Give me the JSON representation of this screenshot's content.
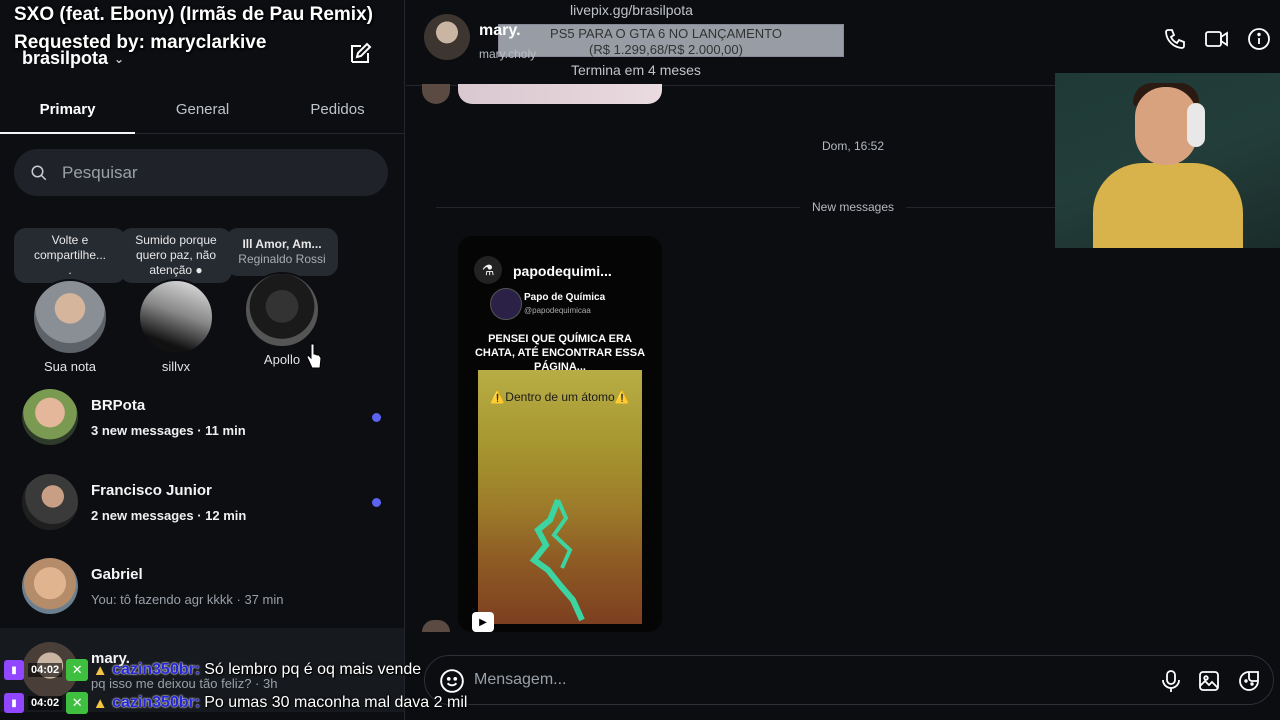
{
  "overlay": {
    "song_line": "SXO (feat. Ebony) (Irmãs de Pau Remix)",
    "requested_line": "Requested by: maryclarkive"
  },
  "sidebar": {
    "account_name": "brasilpota",
    "tabs": [
      {
        "label": "Primary",
        "active": true
      },
      {
        "label": "General",
        "active": false
      },
      {
        "label": "Pedidos",
        "active": false
      }
    ],
    "search_placeholder": "Pesquisar",
    "notes": [
      {
        "bubble_line1": "Volte e",
        "bubble_line2": "compartilhe...",
        "bubble_line3": ".",
        "label": "Sua nota"
      },
      {
        "bubble_line1": "Sumido porque",
        "bubble_line2": "quero paz, não",
        "bubble_line3": "atenção ●",
        "label": "sillvx"
      },
      {
        "bubble_line1": "Ill Amor, Am...",
        "bubble_line2": "Reginaldo Rossi",
        "bubble_line3": "",
        "label": "Apollo"
      }
    ],
    "conversations": [
      {
        "name": "BRPota",
        "preview": "3 new messages · 11 min",
        "unread": true
      },
      {
        "name": "Francisco Junior",
        "preview": "2 new messages · 12 min",
        "unread": true
      },
      {
        "name": "Gabriel",
        "preview": "You: tô fazendo agr kkkk · 37 min",
        "unread": false
      },
      {
        "name": "mary.",
        "preview": "pq isso me deixou tão feliz? · 3h",
        "unread": false
      }
    ]
  },
  "chat": {
    "contact_name": "mary.",
    "contact_username": "mary.choly",
    "timestamp": "Dom, 16:52",
    "new_messages_label": "New messages",
    "reel": {
      "account": "papodequimi...",
      "profile_name": "Papo de Química",
      "profile_handle": "@papodequimicaa",
      "caption": "PENSEI QUE QUÍMICA ERA CHATA, ATÉ ENCONTRAR ESSA PÁGINA...",
      "art_label": "⚠️Dentro de um átomo⚠️"
    },
    "composer_placeholder": "Mensagem..."
  },
  "livepix": {
    "url": "livepix.gg/brasilpota",
    "goal_line1": "PS5 PARA O GTA 6 NO LANÇAMENTO",
    "goal_line2": "(R$ 1.299,68/R$ 2.000,00)",
    "goal_progress": 0.65,
    "time_left": "Termina em 4 meses"
  },
  "stream_chat": [
    {
      "time": "04:02",
      "user": "cazin350br:",
      "message": "Só lembro pq é oq mais vende"
    },
    {
      "time": "04:02",
      "user": "cazin350br:",
      "message": "Po umas 30 maconha mal dava 2 mil"
    }
  ],
  "colors": {
    "background": "#0b0d11",
    "unread_dot": "#5b63f0",
    "twitch": "#9146ff"
  }
}
